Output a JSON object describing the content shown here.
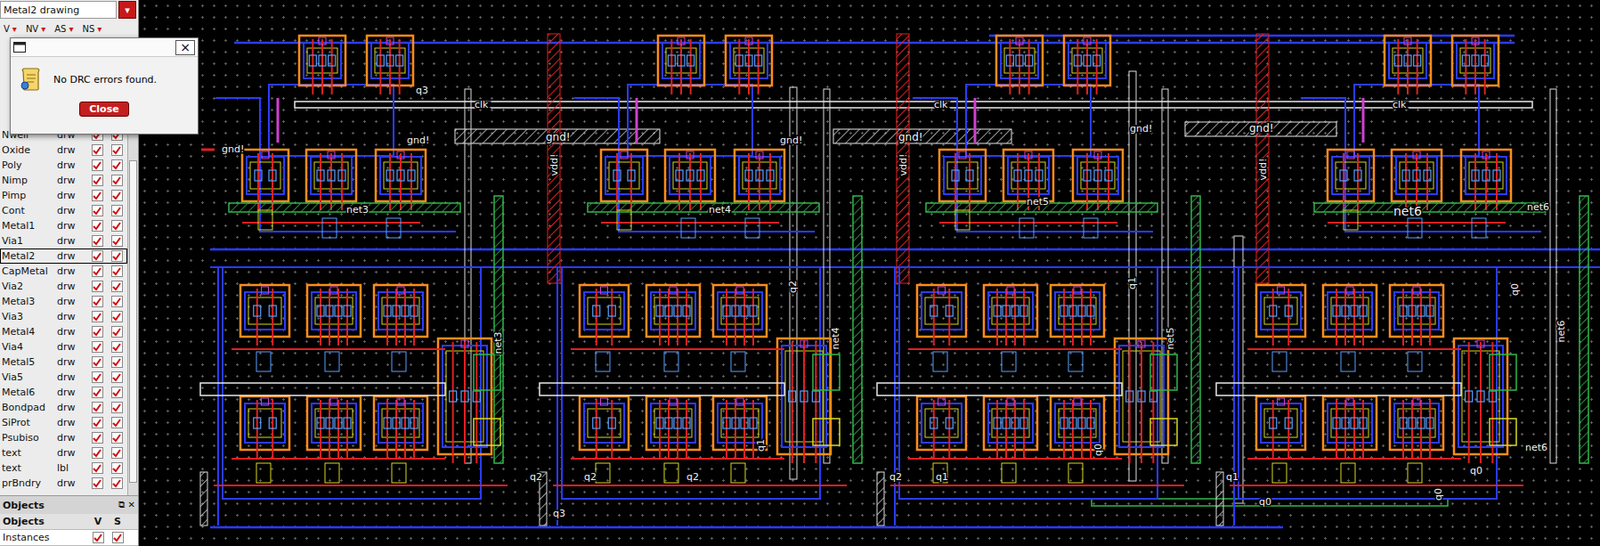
{
  "layer_selector": {
    "value": "Metal2 drawing",
    "arrow": "▾"
  },
  "filters": [
    {
      "label": "V",
      "arrow": "▾"
    },
    {
      "label": "NV",
      "arrow": "▾"
    },
    {
      "label": "AS",
      "arrow": "▾"
    },
    {
      "label": "NS",
      "arrow": "▾"
    }
  ],
  "layers": [
    {
      "name": "Nwell",
      "purpose": "drw",
      "visible": true,
      "selectable": true,
      "selected": false
    },
    {
      "name": "Oxide",
      "purpose": "drw",
      "visible": true,
      "selectable": true,
      "selected": false
    },
    {
      "name": "Poly",
      "purpose": "drw",
      "visible": true,
      "selectable": true,
      "selected": false
    },
    {
      "name": "Nimp",
      "purpose": "drw",
      "visible": true,
      "selectable": true,
      "selected": false
    },
    {
      "name": "Pimp",
      "purpose": "drw",
      "visible": true,
      "selectable": true,
      "selected": false
    },
    {
      "name": "Cont",
      "purpose": "drw",
      "visible": true,
      "selectable": true,
      "selected": false
    },
    {
      "name": "Metal1",
      "purpose": "drw",
      "visible": true,
      "selectable": true,
      "selected": false
    },
    {
      "name": "Via1",
      "purpose": "drw",
      "visible": true,
      "selectable": true,
      "selected": false
    },
    {
      "name": "Metal2",
      "purpose": "drw",
      "visible": true,
      "selectable": true,
      "selected": true
    },
    {
      "name": "CapMetal",
      "purpose": "drw",
      "visible": true,
      "selectable": true,
      "selected": false
    },
    {
      "name": "Via2",
      "purpose": "drw",
      "visible": true,
      "selectable": true,
      "selected": false
    },
    {
      "name": "Metal3",
      "purpose": "drw",
      "visible": true,
      "selectable": true,
      "selected": false
    },
    {
      "name": "Via3",
      "purpose": "drw",
      "visible": true,
      "selectable": true,
      "selected": false
    },
    {
      "name": "Metal4",
      "purpose": "drw",
      "visible": true,
      "selectable": true,
      "selected": false
    },
    {
      "name": "Via4",
      "purpose": "drw",
      "visible": true,
      "selectable": true,
      "selected": false
    },
    {
      "name": "Metal5",
      "purpose": "drw",
      "visible": true,
      "selectable": true,
      "selected": false
    },
    {
      "name": "Via5",
      "purpose": "drw",
      "visible": true,
      "selectable": true,
      "selected": false
    },
    {
      "name": "Metal6",
      "purpose": "drw",
      "visible": true,
      "selectable": true,
      "selected": false
    },
    {
      "name": "Bondpad",
      "purpose": "drw",
      "visible": true,
      "selectable": true,
      "selected": false
    },
    {
      "name": "SiProt",
      "purpose": "drw",
      "visible": true,
      "selectable": true,
      "selected": false
    },
    {
      "name": "Psubiso",
      "purpose": "drw",
      "visible": true,
      "selectable": true,
      "selected": false
    },
    {
      "name": "text",
      "purpose": "drw",
      "visible": true,
      "selectable": true,
      "selected": false
    },
    {
      "name": "text",
      "purpose": "lbl",
      "visible": true,
      "selectable": true,
      "selected": false
    },
    {
      "name": "prBndry",
      "purpose": "drw",
      "visible": true,
      "selectable": true,
      "selected": false
    }
  ],
  "objects_panel": {
    "title": "Objects",
    "header_icons": [
      "⧉",
      "✕"
    ],
    "columns": [
      "Objects",
      "V",
      "S"
    ],
    "rows": [
      {
        "name": "Instances",
        "visible": true,
        "selectable": true
      }
    ]
  },
  "dialog": {
    "message": "No DRC errors found.",
    "button": "Close",
    "close_icon": "×"
  },
  "canvas": {
    "labels": [
      {
        "text": "gnd!",
        "kind": "horizontal"
      },
      {
        "text": "q3",
        "kind": "horizontal"
      },
      {
        "text": "clk",
        "kind": "horizontal"
      },
      {
        "text": "gnd!",
        "kind": "horizontal"
      },
      {
        "text": "gnd!",
        "kind": "horizontal"
      },
      {
        "text": "vdd!",
        "kind": "vertical"
      },
      {
        "text": "net3",
        "kind": "horizontal"
      },
      {
        "text": "net3",
        "kind": "vertical"
      },
      {
        "text": "gnd!",
        "kind": "horizontal"
      },
      {
        "text": "vdd!",
        "kind": "vertical"
      },
      {
        "text": "gnd!",
        "kind": "horizontal"
      },
      {
        "text": "net4",
        "kind": "horizontal"
      },
      {
        "text": "net4",
        "kind": "vertical"
      },
      {
        "text": "q2",
        "kind": "vertical"
      },
      {
        "text": "clk",
        "kind": "horizontal"
      },
      {
        "text": "net5",
        "kind": "horizontal"
      },
      {
        "text": "gnd!",
        "kind": "horizontal"
      },
      {
        "text": "gnd!",
        "kind": "horizontal"
      },
      {
        "text": "vdd!",
        "kind": "vertical"
      },
      {
        "text": "q1",
        "kind": "vertical"
      },
      {
        "text": "net5",
        "kind": "vertical"
      },
      {
        "text": "clk",
        "kind": "horizontal"
      },
      {
        "text": "net6",
        "kind": "horizontal"
      },
      {
        "text": "net6",
        "kind": "horizontal"
      },
      {
        "text": "q0",
        "kind": "vertical"
      },
      {
        "text": "net6",
        "kind": "vertical"
      },
      {
        "text": "net6",
        "kind": "horizontal"
      },
      {
        "text": "q0",
        "kind": "horizontal"
      },
      {
        "text": "q1",
        "kind": "vertical"
      },
      {
        "text": "q2",
        "kind": "horizontal"
      },
      {
        "text": "q2",
        "kind": "horizontal"
      },
      {
        "text": "q2",
        "kind": "horizontal"
      },
      {
        "text": "q3",
        "kind": "horizontal"
      },
      {
        "text": "q2",
        "kind": "horizontal"
      },
      {
        "text": "q1",
        "kind": "horizontal"
      },
      {
        "text": "q0",
        "kind": "vertical"
      },
      {
        "text": "q1",
        "kind": "horizontal"
      },
      {
        "text": "q0",
        "kind": "horizontal"
      },
      {
        "text": "q0",
        "kind": "vertical"
      }
    ]
  }
}
